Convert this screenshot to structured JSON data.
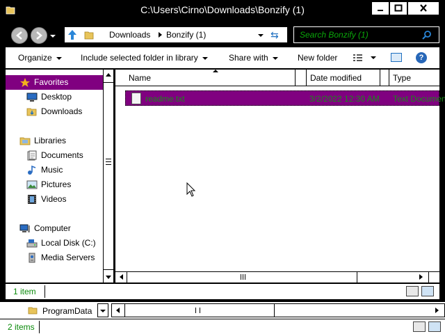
{
  "window": {
    "title": "C:\\Users\\Cirno\\Downloads\\Bonzify (1)"
  },
  "address": {
    "crumbs": [
      "Downloads",
      "Bonzify (1)"
    ],
    "search_placeholder": "Search Bonzify (1)"
  },
  "toolbar": {
    "organize": "Organize",
    "include_library": "Include selected folder in library",
    "share_with": "Share with",
    "new_folder": "New folder",
    "help": "?"
  },
  "sidebar": {
    "favorites": "Favorites",
    "desktop": "Desktop",
    "downloads": "Downloads",
    "libraries": "Libraries",
    "documents": "Documents",
    "music": "Music",
    "pictures": "Pictures",
    "videos": "Videos",
    "computer": "Computer",
    "local_disk": "Local Disk (C:)",
    "media_servers": "Media Servers"
  },
  "columns": {
    "name": "Name",
    "date_modified": "Date modified",
    "type": "Type"
  },
  "files": [
    {
      "name": "readme.txt",
      "date": "3/2/2022 12:30 AM",
      "type": "Text Document"
    }
  ],
  "status": {
    "items": "1 item"
  },
  "background_window": {
    "folder": "ProgramData",
    "items": "2 items"
  },
  "colors": {
    "selection": "#800080",
    "accent_text": "#0aa60a"
  }
}
